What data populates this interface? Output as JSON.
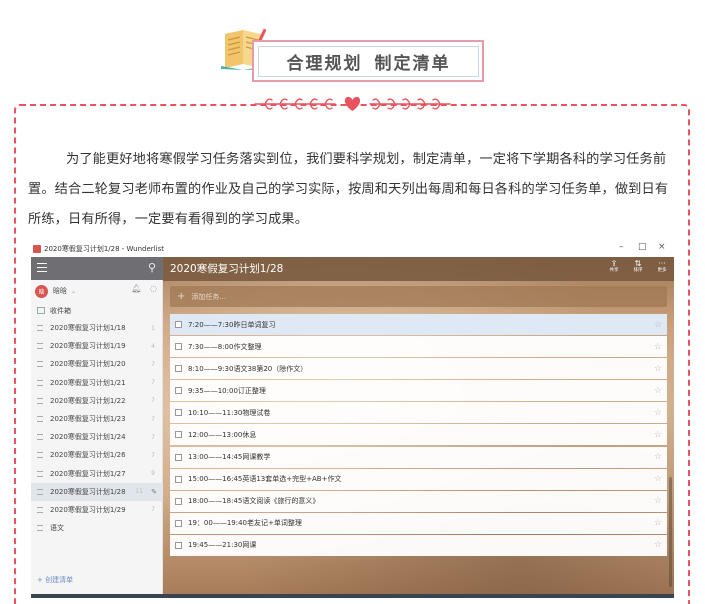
{
  "header": {
    "title_left": "合理规划",
    "title_right": "制定清单"
  },
  "intro": {
    "paragraph": "为了能更好地将寒假学习任务落实到位，我们要科学规划，制定清单，一定将下学期各科的学习任务前置。结合二轮复习老师布置的作业及自己的学习实际，按周和天列出每周和每日各科的学习任务单，做到日有所练，日有所得，一定要有看得到的学习成果。"
  },
  "app": {
    "window_title": "2020寒假复习计划1/28 - Wunderlist",
    "window_controls": [
      "–",
      "□",
      "×"
    ],
    "user_name": "晗晗",
    "avatar_letter": "晗",
    "inbox_label": "收件箱",
    "lists": [
      {
        "label": "2020寒假复习计划1/18",
        "count": "1"
      },
      {
        "label": "2020寒假复习计划1/19",
        "count": "4"
      },
      {
        "label": "2020寒假复习计划1/20",
        "count": "7"
      },
      {
        "label": "2020寒假复习计划1/21",
        "count": "7"
      },
      {
        "label": "2020寒假复习计划1/22",
        "count": "7"
      },
      {
        "label": "2020寒假复习计划1/23",
        "count": "7"
      },
      {
        "label": "2020寒假复习计划1/24",
        "count": "7"
      },
      {
        "label": "2020寒假复习计划1/26",
        "count": "7"
      },
      {
        "label": "2020寒假复习计划1/27",
        "count": "9"
      },
      {
        "label": "2020寒假复习计划1/28",
        "count": "11"
      },
      {
        "label": "2020寒假复习计划1/29",
        "count": "7"
      },
      {
        "label": "语文",
        "count": ""
      }
    ],
    "active_index": 9,
    "create_list_label": "+ 创建清单",
    "main_title": "2020寒假复习计划1/28",
    "head_buttons": [
      {
        "icon": "⇪",
        "label": "共享"
      },
      {
        "icon": "⇅",
        "label": "排序"
      },
      {
        "icon": "···",
        "label": "更多"
      }
    ],
    "add_placeholder": "添加任务...",
    "tasks": [
      "7:20——7:30昨日单词复习",
      "7:30——8:00作文整理",
      "8:10——9:30语文38第20（除作文）",
      "9:35——10:00订正整理",
      "10:10——11:30物理试卷",
      "12:00——13:00休息",
      "13:00——14:45网课教学",
      "15:00——16:45英语13套单选+完型+AB+作文",
      "18:00——18:45语文阅读《旅行的意义》",
      "19：00——19:40老友记+单词整理",
      "19:45——21:30网课"
    ],
    "selected_task_index": 0
  }
}
